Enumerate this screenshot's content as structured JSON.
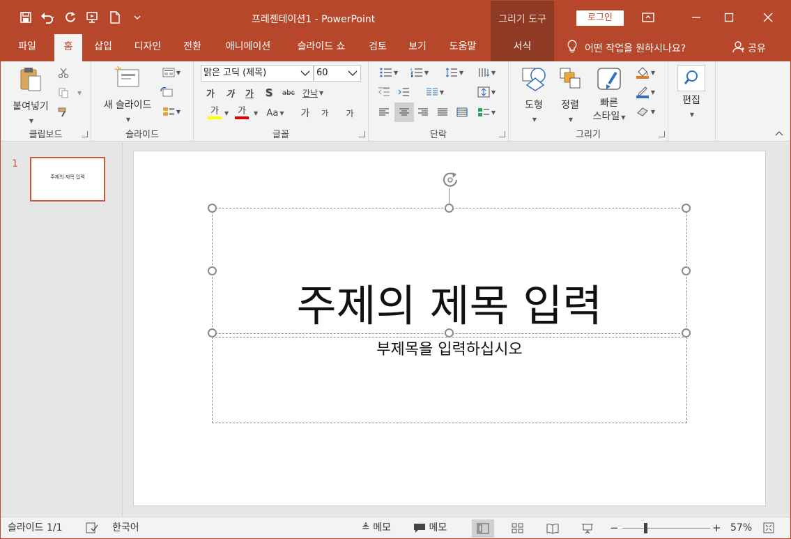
{
  "window": {
    "title": "프레젠테이션1  -  PowerPoint",
    "context_title": "그리기 도구",
    "login_label": "로그인",
    "controls": [
      "minimize-icon",
      "restore-icon",
      "maximize-icon",
      "close-icon"
    ]
  },
  "tabs": [
    {
      "label": "파일"
    },
    {
      "label": "홈"
    },
    {
      "label": "삽입"
    },
    {
      "label": "디자인"
    },
    {
      "label": "전환"
    },
    {
      "label": "애니메이션"
    },
    {
      "label": "슬라이드 쇼"
    },
    {
      "label": "검토"
    },
    {
      "label": "보기"
    },
    {
      "label": "도움말"
    },
    {
      "label": "서식"
    }
  ],
  "active_tab": "홈",
  "tell_me": "어떤 작업을 원하시나요?",
  "share_label": "공유",
  "ribbon": {
    "clipboard": {
      "label": "클립보드",
      "paste": "붙여넣기"
    },
    "slides": {
      "label": "슬라이드",
      "new_slide": "새 슬라이드"
    },
    "font": {
      "label": "글꼴",
      "font_name": "맑은 고딕 (제목)",
      "font_size": "60",
      "bold": "가",
      "italic": "가",
      "underline": "가",
      "shadow": "S",
      "strike": "abc",
      "spacing": "간낙",
      "highlight": "가",
      "font_color": "가",
      "case": "Aa",
      "grow": "가",
      "shrink": "가",
      "clear": "가"
    },
    "paragraph": {
      "label": "단락"
    },
    "drawing": {
      "label": "그리기",
      "shapes": "도형",
      "arrange": "정렬",
      "quick_styles_1": "빠른",
      "quick_styles_2": "스타일"
    },
    "editing": {
      "label": "편집"
    }
  },
  "thumbnails": [
    {
      "number": "1",
      "text": "주제의 제목 입력"
    }
  ],
  "slide": {
    "title": "주제의 제목 입력",
    "subtitle": "부제목을 입력하십시오"
  },
  "status": {
    "slide_info": "슬라이드 1/1",
    "language": "한국어",
    "notes": "메모",
    "comments": "메모",
    "zoom": "57%",
    "zoom_minus": "−",
    "zoom_plus": "+"
  },
  "colors": {
    "accent": "#b7472a",
    "context": "#8e3a24",
    "ribbon": "#f3f3f3"
  }
}
